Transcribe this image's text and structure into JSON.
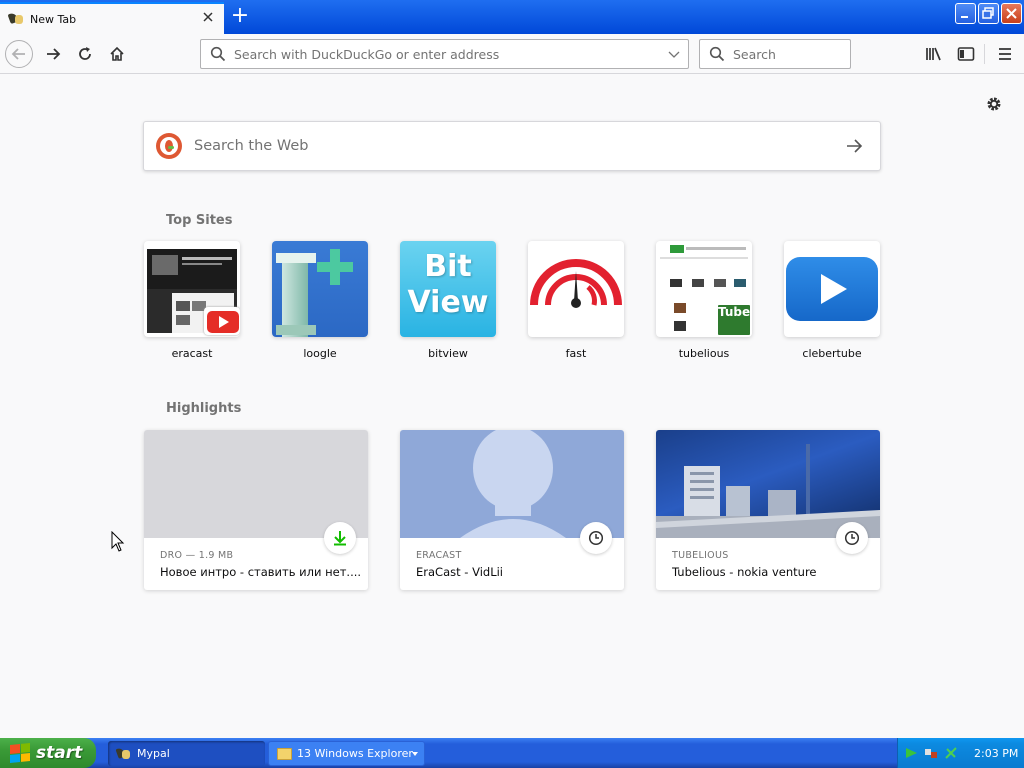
{
  "browser": {
    "tab_title": "New Tab",
    "new_tab_symbol": "+",
    "url_placeholder": "Search with DuckDuckGo or enter address",
    "search_placeholder": "Search"
  },
  "newtab": {
    "web_search_placeholder": "Search the Web",
    "top_sites_title": "Top Sites",
    "highlights_title": "Highlights",
    "top_sites": [
      {
        "label": "eracast"
      },
      {
        "label": "loogle"
      },
      {
        "label": "bitview"
      },
      {
        "label": "fast"
      },
      {
        "label": "tubelious"
      },
      {
        "label": "clebertube"
      }
    ],
    "highlights": [
      {
        "source": "DRO — 1.9 MB",
        "title": "Новое интро - ставить или нет....",
        "badge": "download-icon"
      },
      {
        "source": "ERACAST",
        "title": "EraCast - VidLii",
        "badge": "clock-icon"
      },
      {
        "source": "TUBELIOUS",
        "title": "Tubelious - nokia venture",
        "badge": "clock-icon"
      }
    ],
    "tile_texts": {
      "bitview_line1": "Bit",
      "bitview_line2": "View",
      "tube_text": "Tube"
    }
  },
  "taskbar": {
    "start_label": "start",
    "tasks": [
      {
        "label": "Mypal"
      },
      {
        "label": "13 Windows Explorer"
      }
    ],
    "clock": "2:03 PM"
  },
  "colors": {
    "accent": "#0a84ff",
    "xp_taskbar": "#245edb",
    "xp_start": "#3a9a37",
    "download_green": "#30e60b"
  }
}
